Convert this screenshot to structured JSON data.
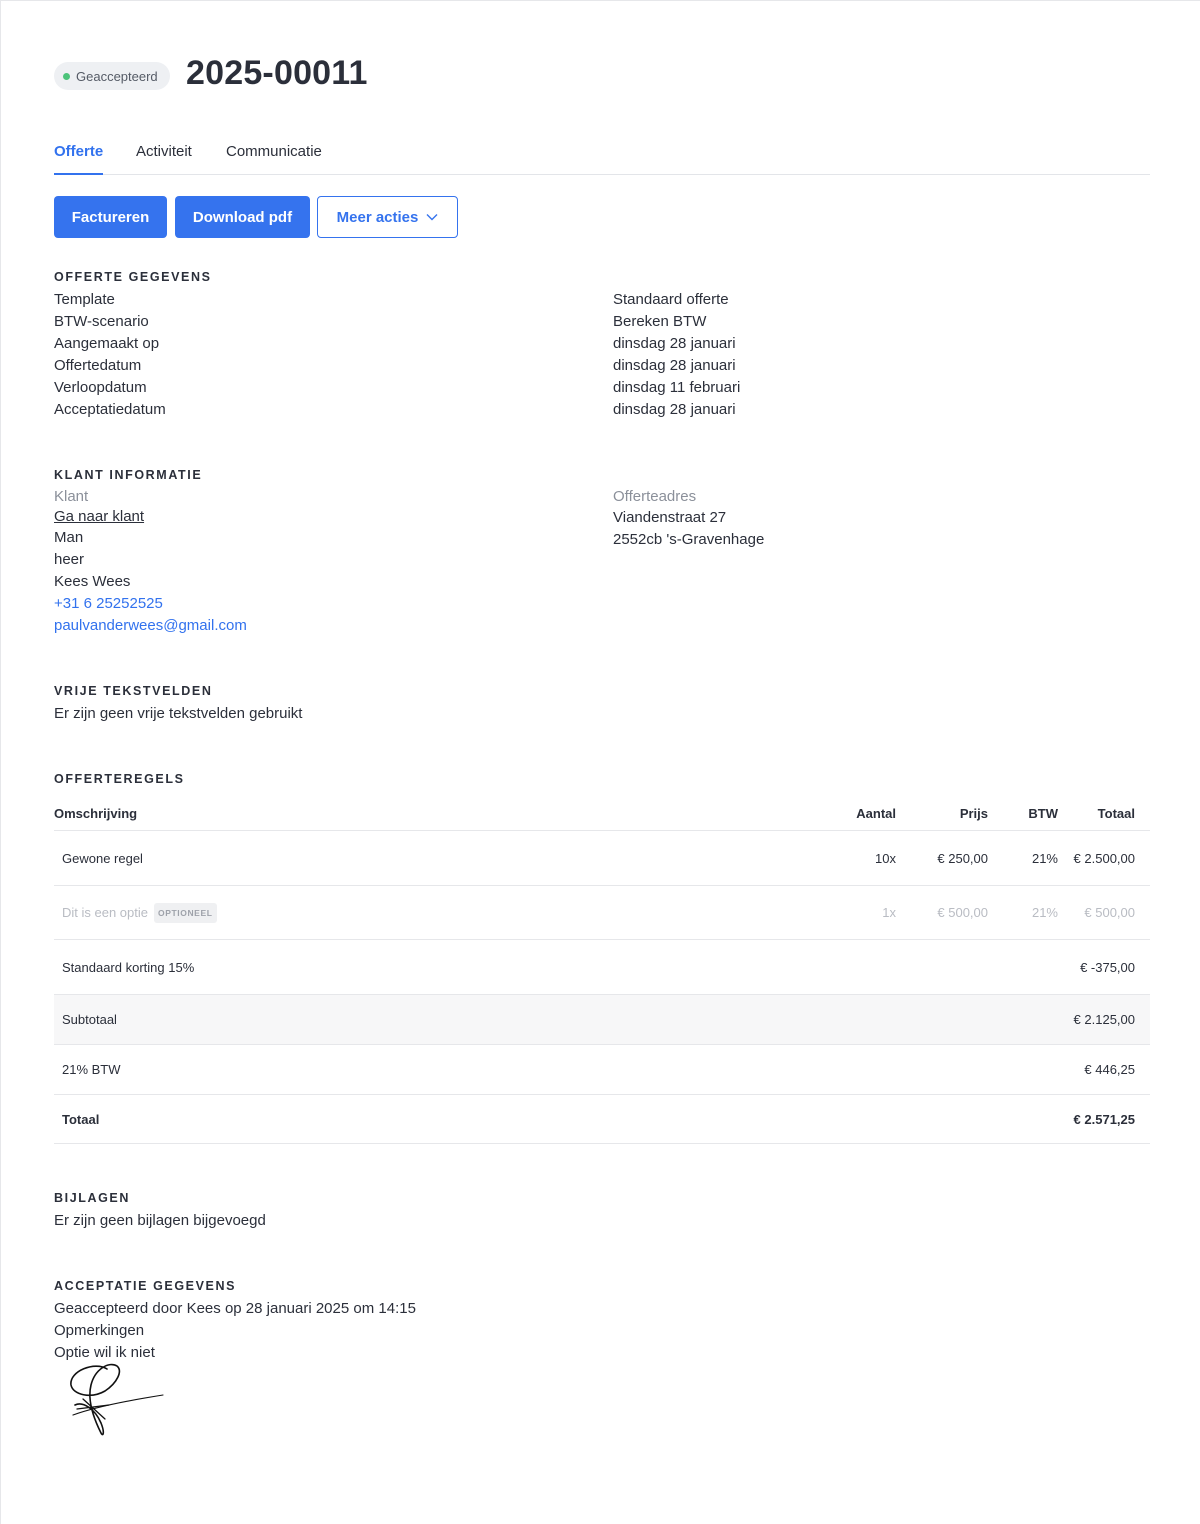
{
  "header": {
    "status": "Geaccepteerd",
    "status_color": "#4cc37a",
    "title": "2025-00011"
  },
  "tabs": [
    {
      "label": "Offerte",
      "active": true
    },
    {
      "label": "Activiteit",
      "active": false
    },
    {
      "label": "Communicatie",
      "active": false
    }
  ],
  "actions": {
    "invoice": "Factureren",
    "download": "Download pdf",
    "more": "Meer acties"
  },
  "offer_details": {
    "title": "OFFERTE GEGEVENS",
    "rows": [
      {
        "label": "Template",
        "value": "Standaard offerte"
      },
      {
        "label": "BTW-scenario",
        "value": "Bereken BTW"
      },
      {
        "label": "Aangemaakt op",
        "value": "dinsdag 28 januari"
      },
      {
        "label": "Offertedatum",
        "value": "dinsdag 28 januari"
      },
      {
        "label": "Verloopdatum",
        "value": "dinsdag 11 februari"
      },
      {
        "label": "Acceptatiedatum",
        "value": "dinsdag 28 januari"
      }
    ]
  },
  "customer": {
    "title": "KLANT INFORMATIE",
    "label": "Klant",
    "goto_link": "Ga naar klant",
    "gender": "Man",
    "salutation": "heer",
    "name": "Kees Wees",
    "phone": "+31 6 25252525",
    "email": "paulvanderwees@gmail.com",
    "address_label": "Offerteadres",
    "address_street": "Viandenstraat 27",
    "address_city": "2552cb 's-Gravenhage"
  },
  "free_text": {
    "title": "VRIJE TEKSTVELDEN",
    "text": "Er zijn geen vrije tekstvelden gebruikt"
  },
  "lines": {
    "title": "OFFERTEREGELS",
    "headers": {
      "description": "Omschrijving",
      "qty": "Aantal",
      "price": "Prijs",
      "vat": "BTW",
      "total": "Totaal"
    },
    "rows": [
      {
        "description": "Gewone regel",
        "qty": "10x",
        "price": "€ 250,00",
        "vat": "21%",
        "total": "€ 2.500,00"
      },
      {
        "description": "Dit is een optie",
        "badge": "OPTIONEEL",
        "qty": "1x",
        "price": "€ 500,00",
        "vat": "21%",
        "total": "€ 500,00"
      }
    ],
    "discount": {
      "label": "Standaard korting 15%",
      "value": "€ -375,00"
    },
    "subtotal": {
      "label": "Subtotaal",
      "value": "€ 2.125,00"
    },
    "vat_total": {
      "label": "21% BTW",
      "value": "€ 446,25"
    },
    "grand_total": {
      "label": "Totaal",
      "value": "€ 2.571,25"
    }
  },
  "attachments": {
    "title": "BIJLAGEN",
    "text": "Er zijn geen bijlagen bijgevoegd"
  },
  "acceptance": {
    "title": "ACCEPTATIE GEGEVENS",
    "accepted_by": "Geaccepteerd door Kees op 28 januari 2025 om 14:15",
    "remarks_label": "Opmerkingen",
    "remarks": "Optie wil ik niet"
  },
  "colors": {
    "accent": "#3573ee",
    "text": "#2b2f3a"
  }
}
